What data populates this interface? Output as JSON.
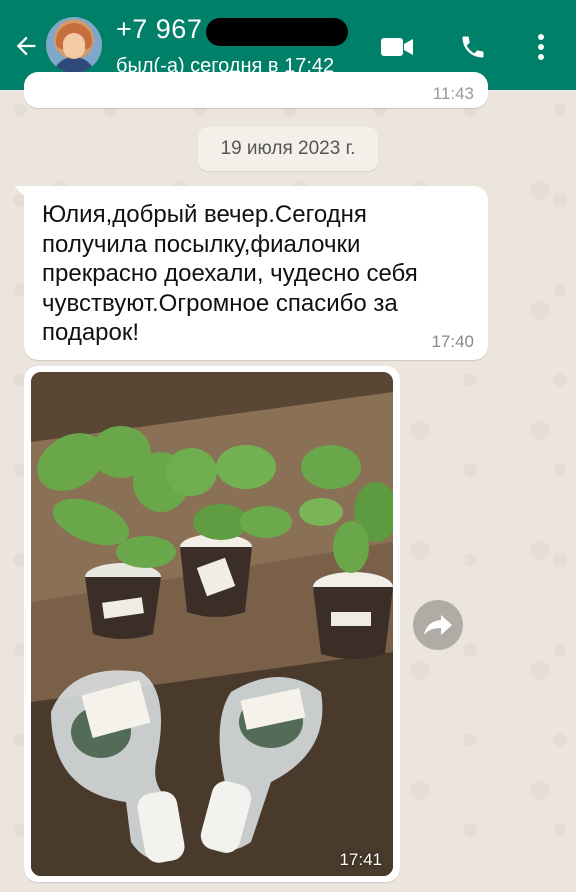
{
  "header": {
    "contact_name": "+7 967",
    "status": "был(-а) сегодня в 17:42",
    "icons": [
      "back-arrow-icon",
      "video-call-icon",
      "phone-icon",
      "more-vertical-icon"
    ]
  },
  "chat": {
    "previous_message_time": "11:43",
    "date_separator": "19 июля 2023 г.",
    "messages": [
      {
        "type": "text",
        "text": "Юлия,добрый вечер.Сегодня получила посылку,фиалочки прекрасно доехали, чудесно себя чувствуют.Огромное спасибо за подарок!",
        "time": "17:40"
      },
      {
        "type": "image",
        "time": "17:41"
      }
    ]
  },
  "colors": {
    "header": "#008069",
    "chat_background": "#ece5dd",
    "bubble": "#ffffff"
  }
}
